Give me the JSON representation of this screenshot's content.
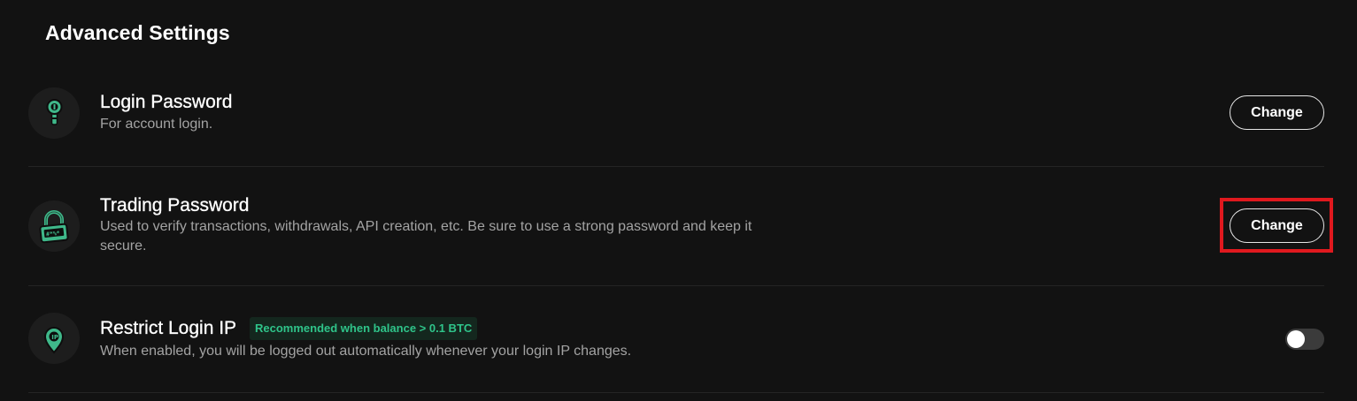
{
  "section": {
    "title": "Advanced Settings"
  },
  "settings": [
    {
      "id": "login-password",
      "icon": "key-icon",
      "title": "Login Password",
      "description": "For account login.",
      "action": {
        "type": "button",
        "label": "Change"
      }
    },
    {
      "id": "trading-password",
      "icon": "padlock-icon",
      "title": "Trading Password",
      "description": "Used to verify transactions, withdrawals, API creation, etc. Be sure to use a strong password and keep it secure.",
      "action": {
        "type": "button",
        "label": "Change",
        "highlighted": true
      }
    },
    {
      "id": "restrict-login-ip",
      "icon": "location-pin-icon",
      "title": "Restrict Login IP",
      "badge": "Recommended when balance > 0.1 BTC",
      "description": "When enabled, you will be logged out automatically whenever your login IP changes.",
      "action": {
        "type": "toggle",
        "enabled": false
      }
    }
  ],
  "colors": {
    "background": "#121212",
    "accent": "#2fc48a",
    "badge_background": "#14271e",
    "highlight": "#e0191e",
    "muted_text": "#a3a3a3"
  }
}
